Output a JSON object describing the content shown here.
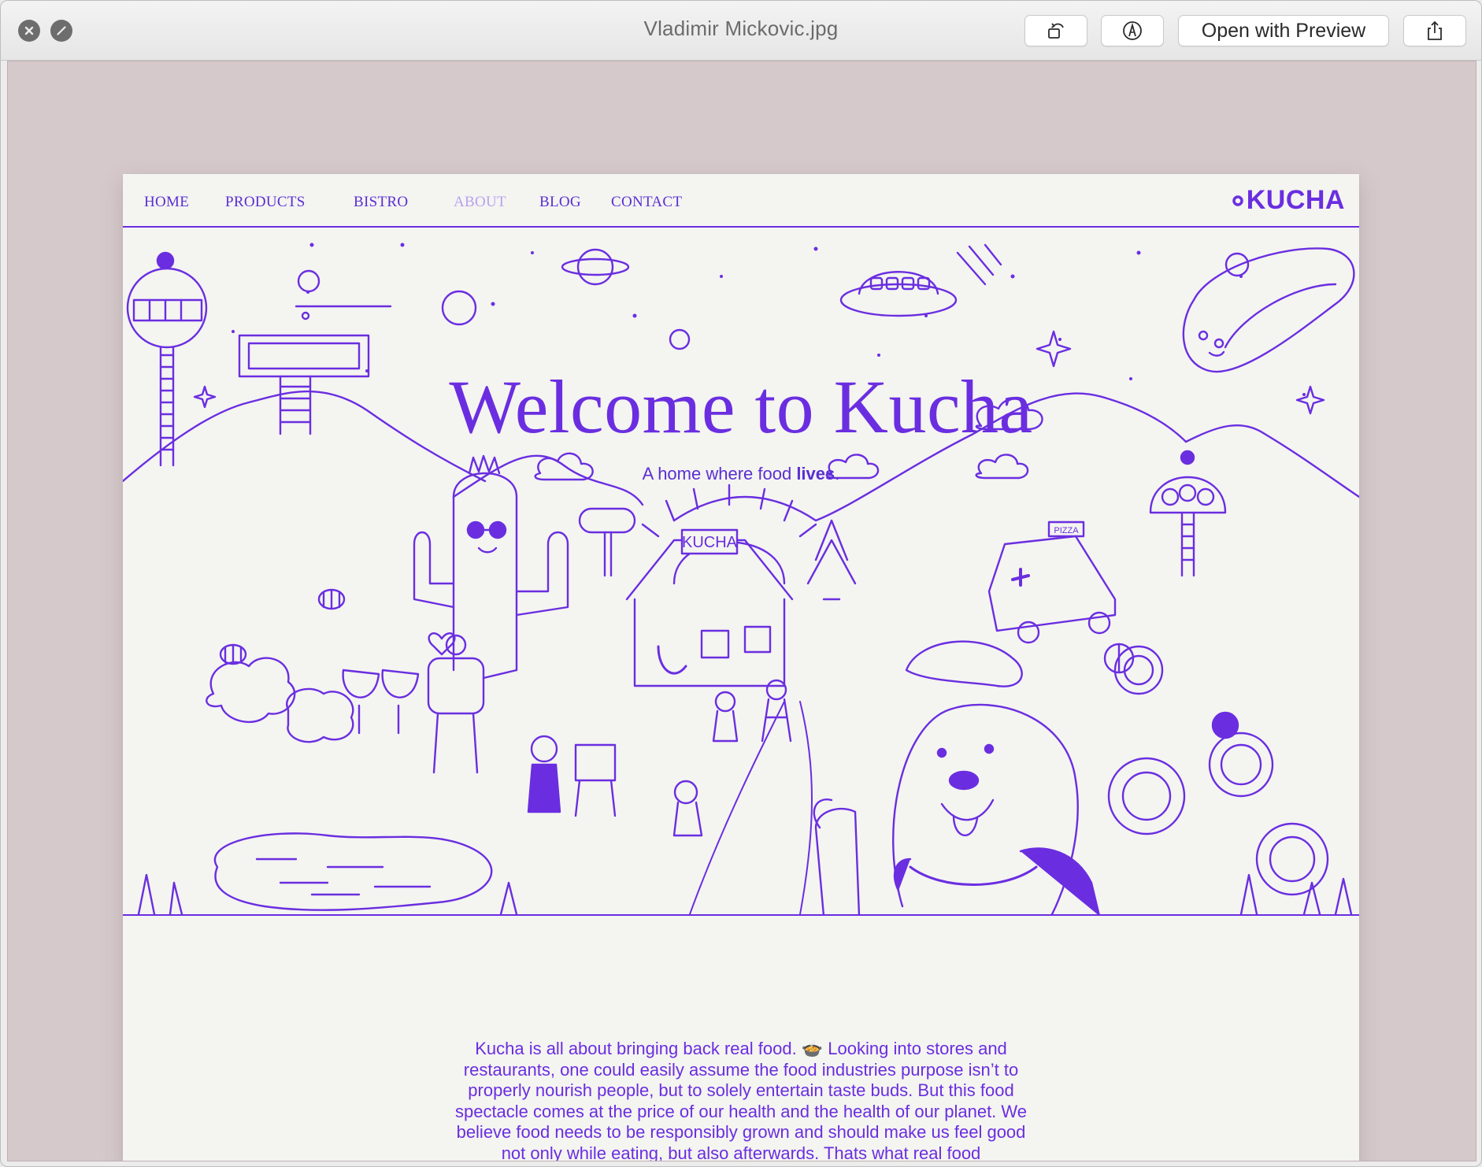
{
  "window": {
    "title": "Vladimir Mickovic.jpg",
    "open_with_label": "Open with Preview",
    "icons": [
      "close-icon",
      "fullscreen-icon",
      "rotate-icon",
      "markup-icon",
      "share-icon"
    ]
  },
  "colors": {
    "brand": "#6a2ee0",
    "nav_text": "#5a2fd1",
    "nav_active": "#b7a2ee",
    "page_bg": "#f4f4f1",
    "stage_bg": "#d6c9cb"
  },
  "site": {
    "nav": [
      {
        "label": "HOME"
      },
      {
        "label": "PRODUCTS"
      },
      {
        "label": "BISTRO"
      },
      {
        "label": "ABOUT",
        "active": true
      },
      {
        "label": "BLOG"
      },
      {
        "label": "CONTACT"
      }
    ],
    "logo": "KUCHA",
    "hero": {
      "title": "Welcome to Kucha",
      "subtitle_prefix": "A home where food ",
      "subtitle_bold": "lives",
      "subtitle_suffix": ".",
      "house_sign": "KUCHA",
      "truck_sign": "PIZZA"
    },
    "intro": "Kucha is all about bringing back real food. 🍲 Looking into stores and restaurants, one could easily assume the food industries purpose isn’t to properly nourish people, but to solely entertain taste buds. But this food spectacle comes at the price of our health and the health of our planet. We believe food needs to be responsibly grown and should make us feel good not only while eating, but also afterwards. Thats what real food"
  }
}
